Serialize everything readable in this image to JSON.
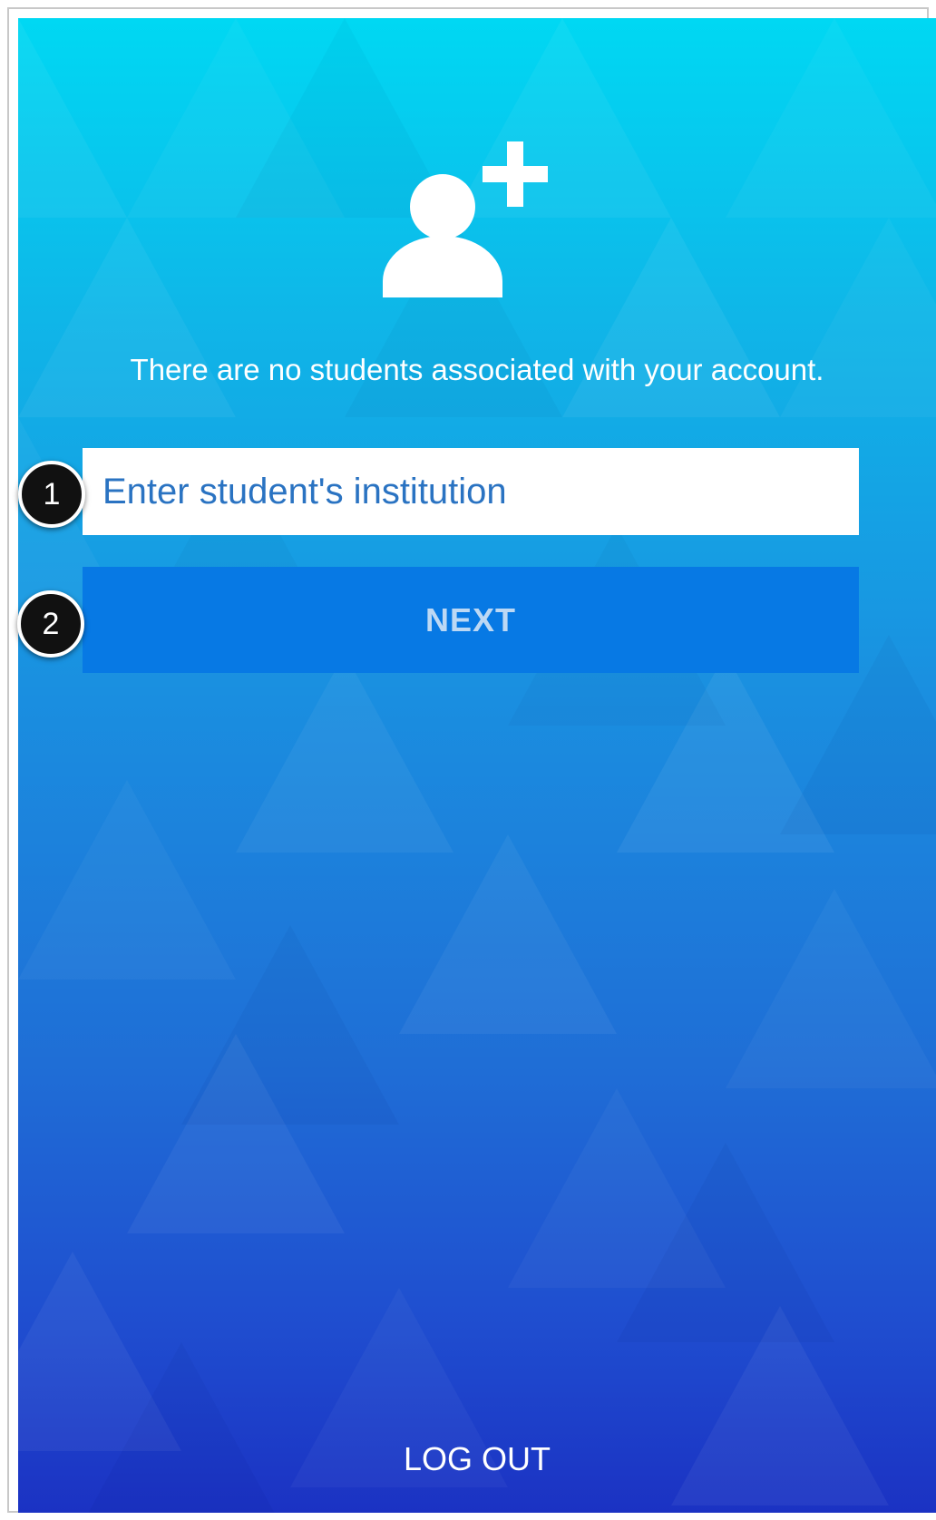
{
  "empty_state": {
    "icon": "add-person-icon",
    "message": "There are no students associated with your account."
  },
  "institution_input": {
    "placeholder": "Enter student's institution",
    "value": ""
  },
  "next_button": {
    "label": "NEXT"
  },
  "logout_button": {
    "label": "LOG OUT"
  },
  "callouts": [
    {
      "label": "1"
    },
    {
      "label": "2"
    }
  ],
  "colors": {
    "gradient_top": "#00d8f3",
    "gradient_bottom": "#1b32c3",
    "button_bg": "#0779e4",
    "input_text": "#2a73c2"
  }
}
